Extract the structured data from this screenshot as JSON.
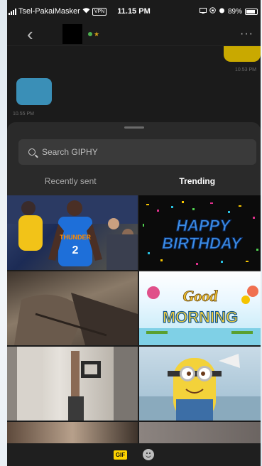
{
  "status_bar": {
    "carrier": "Tsel-PakaiMasker",
    "vpn": "VPN",
    "time": "11.15 PM",
    "battery": "89%",
    "battery_level": 0.89
  },
  "chat": {
    "outgoing_time": "10.53 PM",
    "incoming_time": "10.55 PM"
  },
  "giphy": {
    "search_placeholder": "Search GIPHY",
    "tabs": [
      {
        "label": "Recently sent",
        "active": false
      },
      {
        "label": "Trending",
        "active": true
      }
    ],
    "gif_badge": "GIF",
    "gifs": [
      {
        "name": "basketball-gif",
        "text": ""
      },
      {
        "name": "happy-birthday-gif",
        "text": "HAPPY BIRTHDAY"
      },
      {
        "name": "vintage-gif",
        "text": ""
      },
      {
        "name": "good-morning-gif",
        "text": "Good MORNING"
      },
      {
        "name": "dancing-gif",
        "text": ""
      },
      {
        "name": "minion-gif",
        "text": ""
      },
      {
        "name": "gif-7",
        "text": ""
      },
      {
        "name": "gif-8",
        "text": ""
      }
    ],
    "jersey_text": "THUNDER",
    "jersey_number": "2"
  },
  "colors": {
    "background": "#1b1b1b",
    "outgoing_bubble": "#c9a900",
    "incoming_bubble": "#3a8fb7",
    "giphy_badge": "#ffd400"
  }
}
